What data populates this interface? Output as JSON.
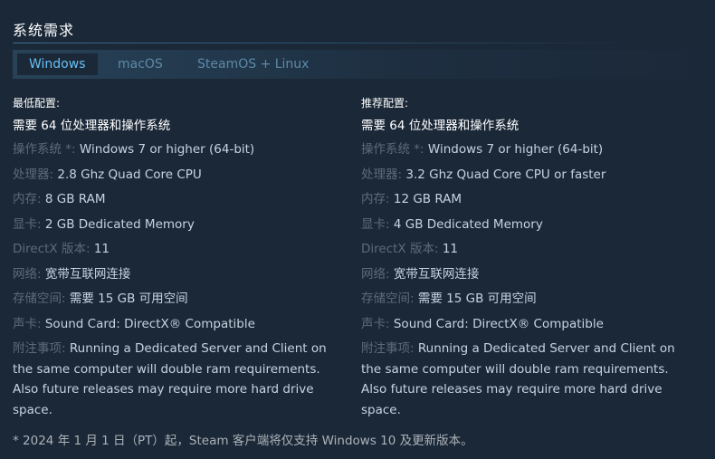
{
  "section": {
    "title": "系统需求"
  },
  "tabs": [
    {
      "label": "Windows",
      "active": true
    },
    {
      "label": "macOS",
      "active": false
    },
    {
      "label": "SteamOS + Linux",
      "active": false
    }
  ],
  "minimum": {
    "heading": "最低配置:",
    "bits_note": "需要 64 位处理器和操作系统",
    "os_label": "操作系统 *:",
    "os_value": "Windows 7 or higher (64-bit)",
    "cpu_label": "处理器:",
    "cpu_value": "2.8 Ghz Quad Core CPU",
    "ram_label": "内存:",
    "ram_value": "8 GB RAM",
    "gpu_label": "显卡:",
    "gpu_value": "2 GB Dedicated Memory",
    "dx_label": "DirectX 版本:",
    "dx_value": "11",
    "net_label": "网络:",
    "net_value": "宽带互联网连接",
    "storage_label": "存储空间:",
    "storage_value": "需要 15 GB 可用空间",
    "sound_label": "声卡:",
    "sound_value": "Sound Card: DirectX® Compatible",
    "notes_label": "附注事项:",
    "notes_value": "Running a Dedicated Server and Client on the same computer will double ram requirements. Also future releases may require more hard drive space."
  },
  "recommended": {
    "heading": "推荐配置:",
    "bits_note": "需要 64 位处理器和操作系统",
    "os_label": "操作系统 *:",
    "os_value": "Windows 7 or higher (64-bit)",
    "cpu_label": "处理器:",
    "cpu_value": "3.2 Ghz Quad Core CPU or faster",
    "ram_label": "内存:",
    "ram_value": "12 GB RAM",
    "gpu_label": "显卡:",
    "gpu_value": "4 GB Dedicated Memory",
    "dx_label": "DirectX 版本:",
    "dx_value": "11",
    "net_label": "网络:",
    "net_value": "宽带互联网连接",
    "storage_label": "存储空间:",
    "storage_value": "需要 15 GB 可用空间",
    "sound_label": "声卡:",
    "sound_value": "Sound Card: DirectX® Compatible",
    "notes_label": "附注事项:",
    "notes_value": "Running a Dedicated Server and Client on the same computer will double ram requirements. Also future releases may require more hard drive space."
  },
  "footnote": "* 2024 年 1 月 1 日（PT）起，Steam 客户端将仅支持 Windows 10 及更新版本。"
}
